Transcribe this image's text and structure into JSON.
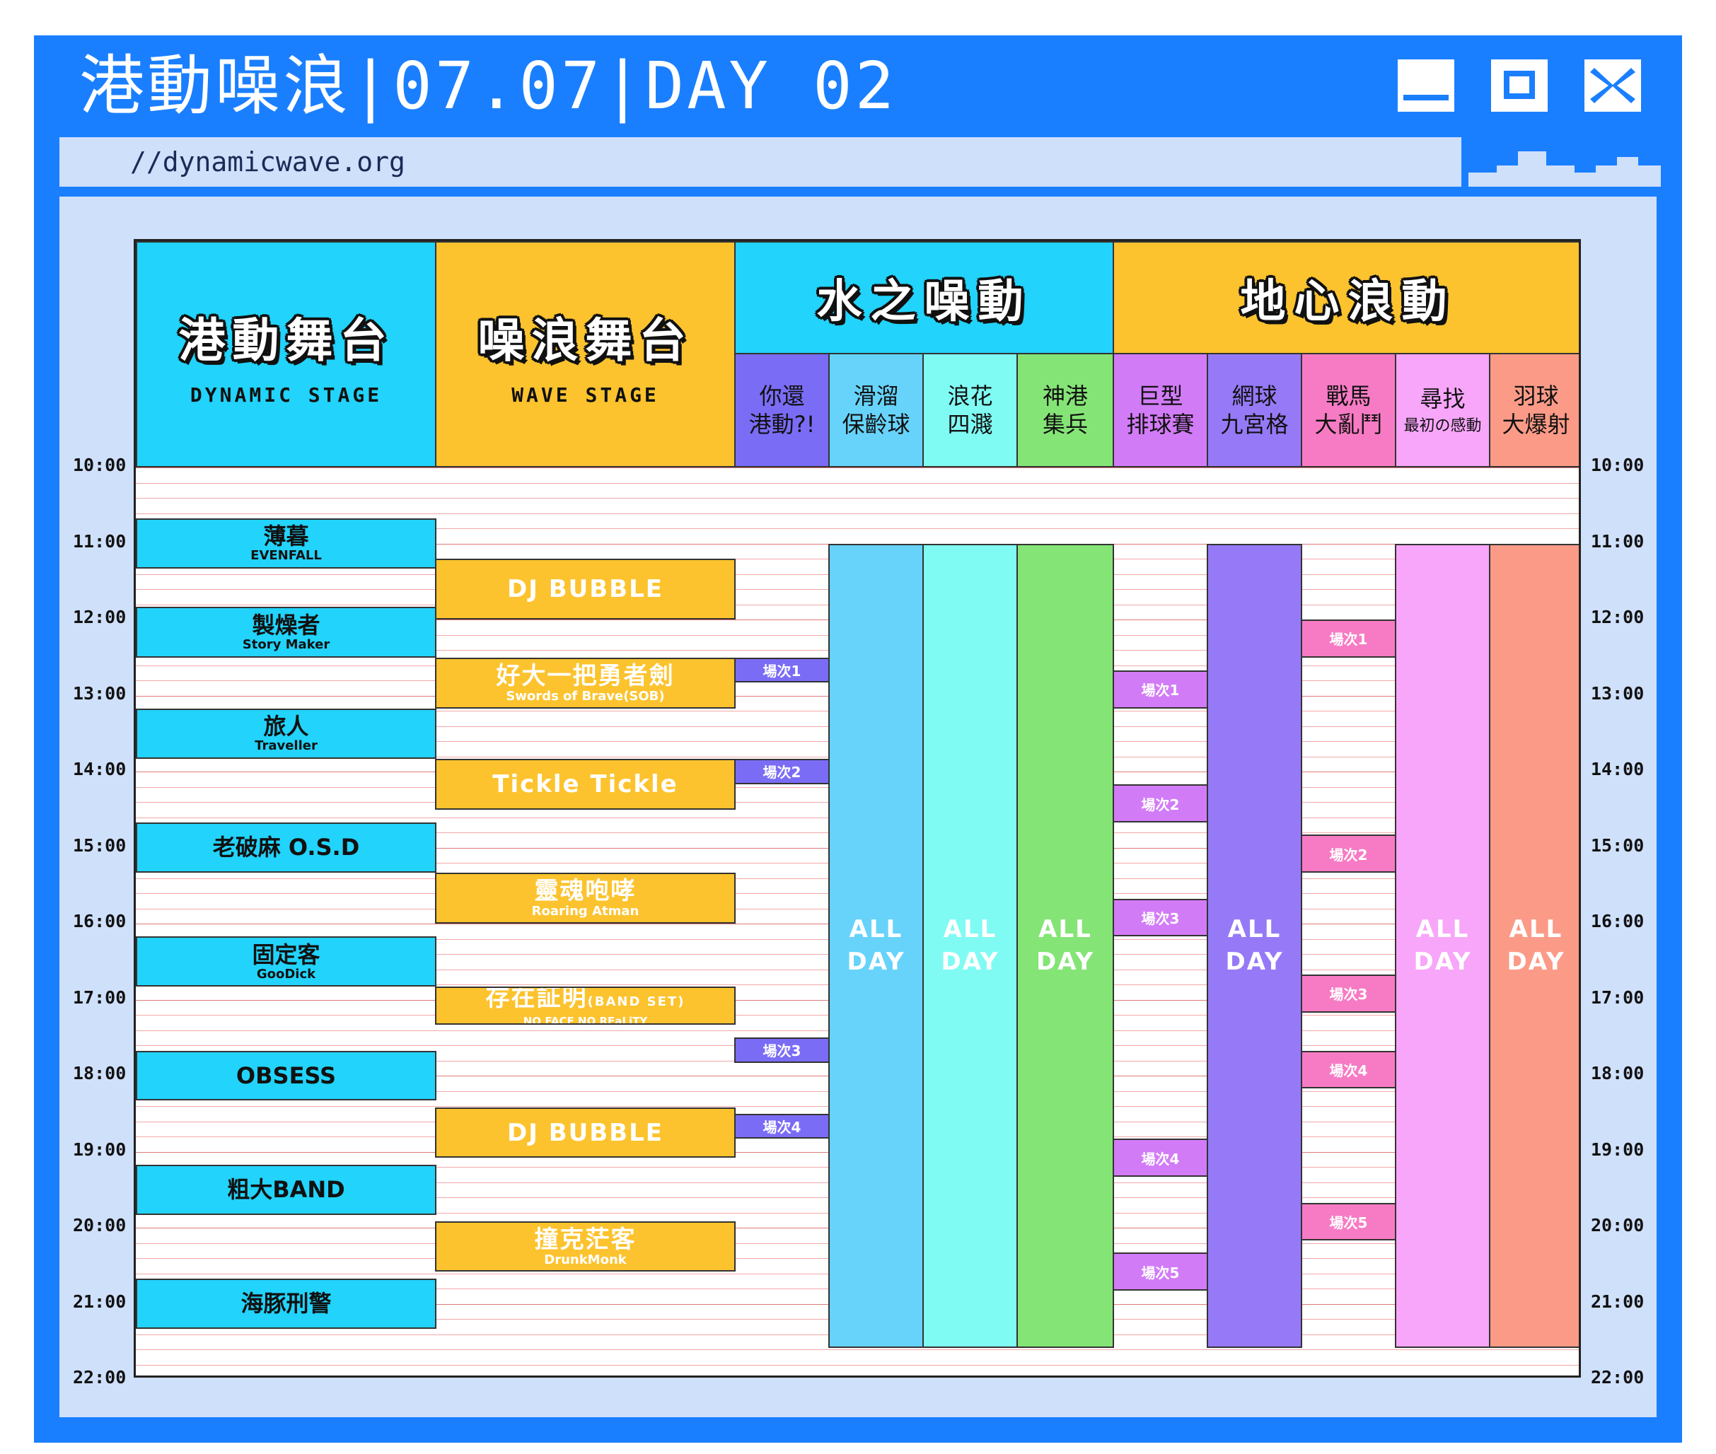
{
  "window": {
    "title": "港動噪浪|07.07|DAY 02",
    "url": "//dynamicwave.org",
    "controls": [
      "minimize-icon",
      "maximize-icon",
      "close-icon"
    ]
  },
  "colors": {
    "frame": "#1a7fff",
    "panel": "#cfe0fb",
    "dynamic_stage": "#22d3fb",
    "wave_stage": "#fcc32e",
    "water_activity_1": "#7b6cf6",
    "water_activity_2": "#67d3fb",
    "water_activity_3": "#80fbf4",
    "water_activity_4": "#85e476",
    "earth_activity_1": "#d27bf7",
    "earth_activity_2": "#9679f6",
    "earth_activity_3": "#f77bc4",
    "earth_activity_4": "#f7a6f9",
    "earth_activity_5": "#fb9b87"
  },
  "times": [
    "10:00",
    "11:00",
    "12:00",
    "13:00",
    "14:00",
    "15:00",
    "16:00",
    "17:00",
    "18:00",
    "19:00",
    "20:00",
    "21:00",
    "22:00"
  ],
  "headers": {
    "dynamic_stage": {
      "zh": "港動舞台",
      "en": "DYNAMIC STAGE"
    },
    "wave_stage": {
      "zh": "噪浪舞台",
      "en": "WAVE STAGE"
    },
    "water_group": "水之噪動",
    "earth_group": "地心浪動",
    "water_activities": [
      {
        "line1": "你還",
        "line2": "港動?!"
      },
      {
        "line1": "滑溜",
        "line2": "保齡球"
      },
      {
        "line1": "浪花",
        "line2": "四濺"
      },
      {
        "line1": "神港",
        "line2": "集兵"
      }
    ],
    "earth_activities": [
      {
        "line1": "巨型",
        "line2": "排球賽"
      },
      {
        "line1": "網球",
        "line2": "九宮格"
      },
      {
        "line1": "戰馬",
        "line2": "大亂鬥"
      },
      {
        "line1": "尋找",
        "line2": "最初の感動"
      },
      {
        "line1": "羽球",
        "line2": "大爆射"
      }
    ]
  },
  "dynamic_performances": [
    {
      "name": "薄暮",
      "en": "EVENFALL"
    },
    {
      "name": "製燥者",
      "en": "Story Maker"
    },
    {
      "name": "旅人",
      "en": "Traveller"
    },
    {
      "name": "老破麻 O.S.D",
      "en": ""
    },
    {
      "name": "固定客",
      "en": "GooDick"
    },
    {
      "name": "OBSESS",
      "en": ""
    },
    {
      "name": "粗大BAND",
      "en": ""
    },
    {
      "name": "海豚刑警",
      "en": ""
    }
  ],
  "wave_performances": [
    {
      "name": "DJ BUBBLE",
      "en": ""
    },
    {
      "name": "好大一把勇者劍",
      "en": "Swords of Brave(SOB)"
    },
    {
      "name": "Tickle Tickle",
      "en": ""
    },
    {
      "name": "靈魂咆哮",
      "en": "Roaring Atman"
    },
    {
      "name": "存在証明",
      "sub": "(BAND SET)",
      "en": "NO FACE NO REaLiTY"
    },
    {
      "name": "DJ BUBBLE",
      "en": ""
    },
    {
      "name": "撞克茫客",
      "en": "DrunkMonk"
    }
  ],
  "sessions": {
    "water_1": [
      "場次1",
      "場次2",
      "場次3",
      "場次4"
    ],
    "earth_1": [
      "場次1",
      "場次2",
      "場次3",
      "場次4",
      "場次5"
    ],
    "earth_3": [
      "場次1",
      "場次2",
      "場次3",
      "場次4",
      "場次5"
    ]
  },
  "all_day": {
    "line1": "ALL",
    "line2": "DAY"
  }
}
